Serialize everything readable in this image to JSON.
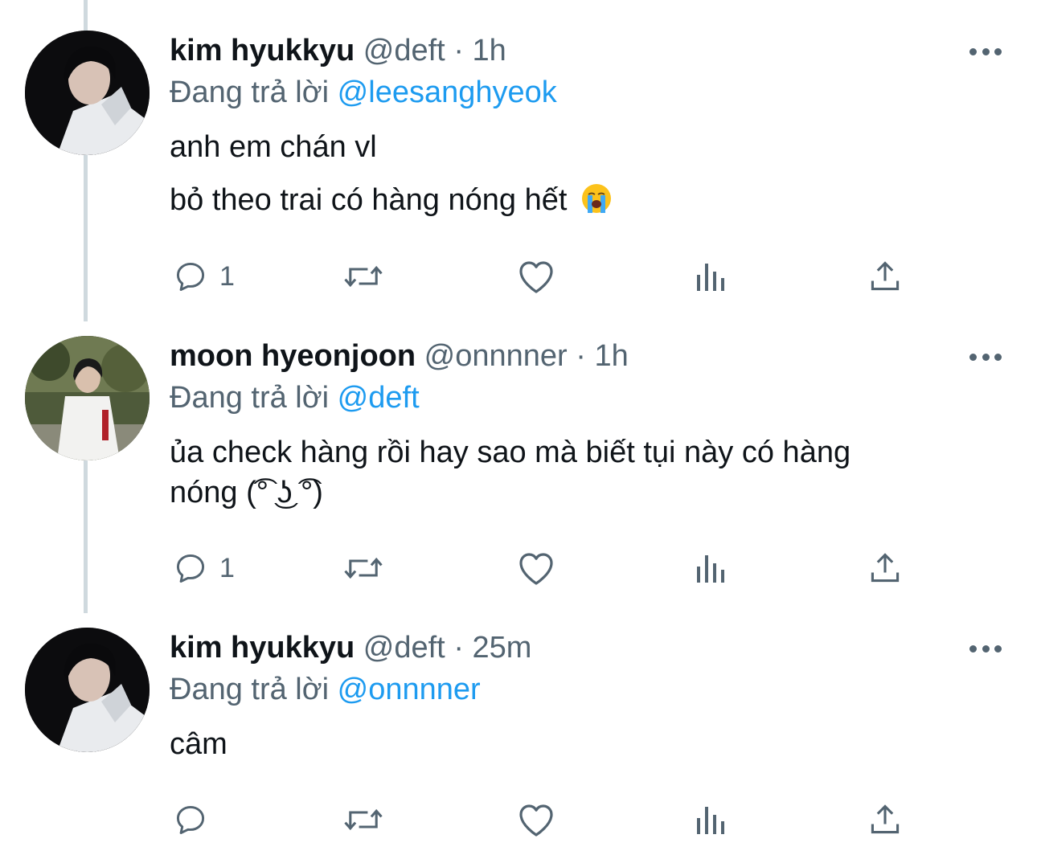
{
  "tweets": [
    {
      "name": "kim hyukkyu",
      "handle": "@deft",
      "dot": "·",
      "time": "1h",
      "reply_prefix": "Đang trả lời",
      "reply_to": "@leesanghyeok",
      "lines": [
        "anh em chán vl",
        "bỏ theo trai có hàng nóng hết"
      ],
      "emoji": "loudly-crying-face",
      "reply_count": "1"
    },
    {
      "name": "moon hyeonjoon",
      "handle": "@onnnner",
      "dot": "·",
      "time": "1h",
      "reply_prefix": "Đang trả lời",
      "reply_to": "@deft",
      "lines": [
        "ủa check hàng rồi hay sao mà biết tụi này có hàng",
        "nóng (͡° ͜ʖ ͡°)"
      ],
      "reply_count": "1"
    },
    {
      "name": "kim hyukkyu",
      "handle": "@deft",
      "dot": "·",
      "time": "25m",
      "reply_prefix": "Đang trả lời",
      "reply_to": "@onnnner",
      "lines": [
        "câm"
      ],
      "reply_count": ""
    }
  ],
  "icons": {
    "reply": "reply-icon",
    "retweet": "retweet-icon",
    "like": "heart-icon",
    "analytics": "analytics-icon",
    "share": "share-icon",
    "more": "more-icon"
  },
  "colors": {
    "text": "#0f1419",
    "secondary": "#536471",
    "link": "#1d9bf0",
    "thread_line": "#cfd9de"
  }
}
